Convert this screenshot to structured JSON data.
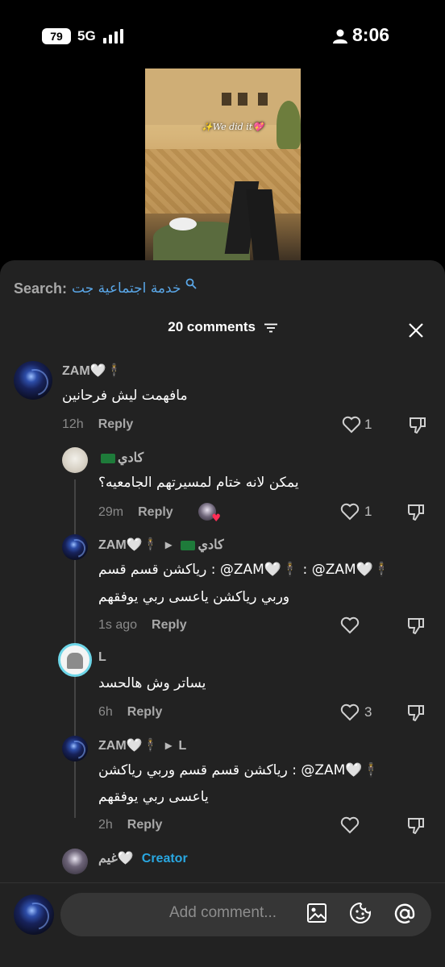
{
  "status_bar": {
    "battery": "79",
    "network": "5G",
    "time": "8:06"
  },
  "video": {
    "caption": "✨We did it💖"
  },
  "search": {
    "label": "Search:",
    "query": "خدمة اجتماعية جت"
  },
  "header": {
    "title": "20 comments"
  },
  "comments": [
    {
      "user": "ZAM🤍🕴",
      "text": "مافهمت ليش فرحانين",
      "time": "12h",
      "reply": "Reply",
      "likes": "1"
    },
    {
      "user": "كادي",
      "text": "يمكن لانه ختام لمسيرتهم الجامعيه؟",
      "time": "29m",
      "reply": "Reply",
      "likes": "1"
    },
    {
      "user": "ZAM🤍🕴",
      "reply_to": "كادي",
      "text": "رياكشن قسم قسم : @ZAM🤍🕴 : @ZAM🤍🕴",
      "text2": "وربي رياكشن ياعسى ربي يوفقهم",
      "time": "1s ago",
      "reply": "Reply",
      "likes": ""
    },
    {
      "user": "L",
      "text": "يساتر وش هالحسد",
      "time": "6h",
      "reply": "Reply",
      "likes": "3"
    },
    {
      "user": "ZAM🤍🕴",
      "reply_to": "L",
      "text": "رياكشن قسم قسم وربي رياكشن : @ZAM🤍🕴",
      "text2": "ياعسى ربي يوفقهم",
      "time": "2h",
      "reply": "Reply",
      "likes": ""
    },
    {
      "user": "غيم🤍",
      "badge": "Creator",
      "text": ""
    }
  ],
  "input": {
    "placeholder": "Add comment..."
  }
}
